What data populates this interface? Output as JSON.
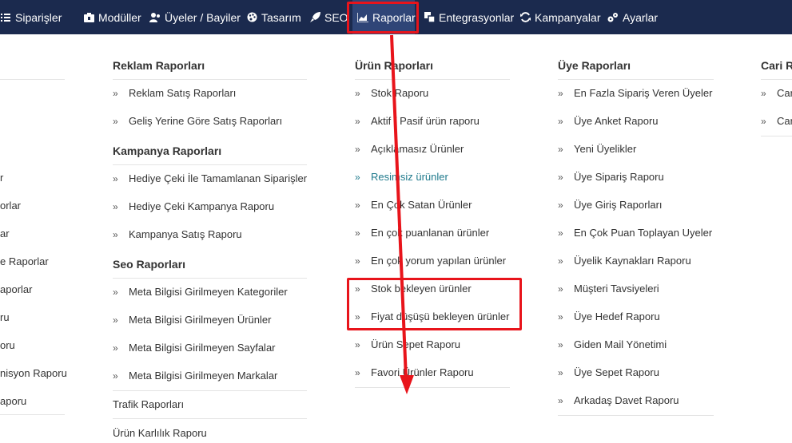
{
  "nav": {
    "items": [
      {
        "label": "Siparişler",
        "icon": "list-icon"
      },
      {
        "label": "Modüller",
        "icon": "box-icon"
      },
      {
        "label": "Üyeler / Bayiler",
        "icon": "users-icon"
      },
      {
        "label": "Tasarım",
        "icon": "palette-icon"
      },
      {
        "label": "SEO",
        "icon": "rocket-icon"
      },
      {
        "label": "Raporlar",
        "icon": "chart-icon"
      },
      {
        "label": "Entegrasyonlar",
        "icon": "integration-icon"
      },
      {
        "label": "Kampanyalar",
        "icon": "refresh-icon"
      },
      {
        "label": "Ayarlar",
        "icon": "gears-icon"
      }
    ]
  },
  "left_partial": [
    "r",
    "orlar",
    "ar",
    "e Raporlar",
    "aporlar",
    "ru",
    "oru",
    "nisyon Raporu",
    "aporu"
  ],
  "col_reklam": {
    "title": "Reklam Raporları",
    "items": [
      "Reklam Satış Raporları",
      "Geliş Yerine Göre Satış Raporları"
    ]
  },
  "col_kampanya": {
    "title": "Kampanya Raporları",
    "items": [
      "Hediye Çeki İle Tamamlanan Siparişler",
      "Hediye Çeki Kampanya Raporu",
      "Kampanya Satış Raporu"
    ]
  },
  "col_seo": {
    "title": "Seo Raporları",
    "items": [
      "Meta Bilgisi Girilmeyen Kategoriler",
      "Meta Bilgisi Girilmeyen Ürünler",
      "Meta Bilgisi Girilmeyen Sayfalar",
      "Meta Bilgisi Girilmeyen Markalar"
    ]
  },
  "col_trafik": {
    "title": "Trafik Raporları"
  },
  "col_karlilik": {
    "title": "Ürün Karlılık Raporu"
  },
  "col_urun": {
    "title": "Ürün Raporları",
    "items": [
      "Stok Raporu",
      "Aktif / Pasif ürün raporu",
      "Açıklamasız Ürünler",
      "Resimsiz ürünler",
      "En Çok Satan Ürünler",
      "En çok puanlanan ürünler",
      "En çok yorum yapılan ürünler",
      "Stok bekleyen ürünler",
      "Fiyat düşüşü bekleyen ürünler",
      "Ürün Sepet Raporu",
      "Favori Ürünler Raporu"
    ]
  },
  "col_uye": {
    "title": "Üye Raporları",
    "items": [
      "En Fazla Sipariş Veren Üyeler",
      "Üye Anket Raporu",
      "Yeni Üyelikler",
      "Üye Sipariş Raporu",
      "Üye Giriş Raporları",
      "En Çok Puan Toplayan Uyeler",
      "Üyelik Kaynakları Raporu",
      "Müşteri Tavsiyeleri",
      "Üye Hedef Raporu",
      "Giden Mail Yönetimi",
      "Üye Sepet Raporu",
      "Arkadaş Davet Raporu"
    ]
  },
  "col_cari": {
    "title": "Cari R",
    "items": [
      "Car",
      "Car"
    ]
  },
  "colors": {
    "nav_bg": "#1b2a4e",
    "highlight": "#e8141b",
    "link": "#1f7a8c"
  }
}
